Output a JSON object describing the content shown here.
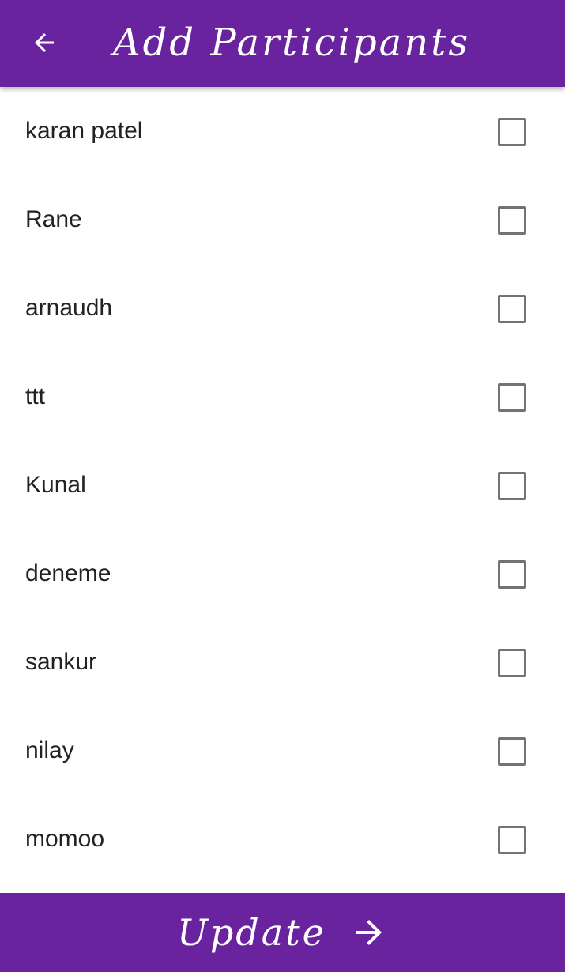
{
  "header": {
    "back_icon": "arrow-back-icon",
    "title": "Add  Participants"
  },
  "participants": [
    {
      "name": "karan patel",
      "checked": false
    },
    {
      "name": "Rane",
      "checked": false
    },
    {
      "name": "arnaudh",
      "checked": false
    },
    {
      "name": "ttt",
      "checked": false
    },
    {
      "name": "Kunal",
      "checked": false
    },
    {
      "name": "deneme",
      "checked": false
    },
    {
      "name": "sankur",
      "checked": false
    },
    {
      "name": "nilay",
      "checked": false
    },
    {
      "name": "momoo",
      "checked": false
    }
  ],
  "footer": {
    "update_label": "Update",
    "arrow_icon": "arrow-forward-icon"
  },
  "colors": {
    "primary": "#6a239e",
    "text": "#222222",
    "checkbox_border": "#737373",
    "background": "#ffffff"
  }
}
